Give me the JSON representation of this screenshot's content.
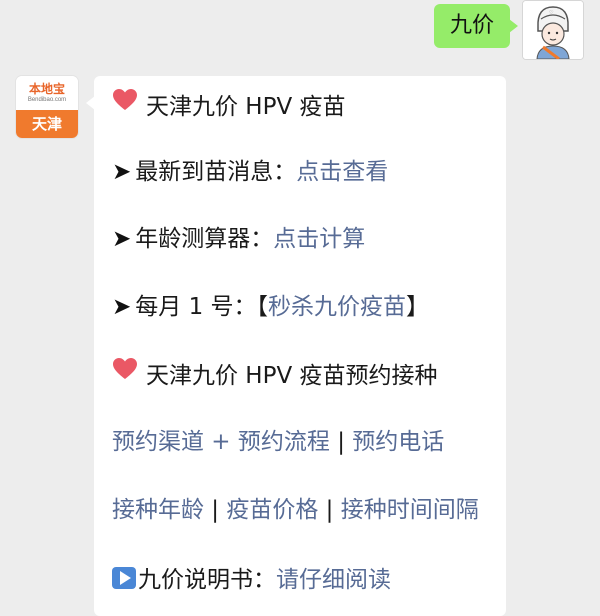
{
  "outgoing_message": {
    "text": "九价"
  },
  "account": {
    "brand": "本地宝",
    "site": "Bendibao.com",
    "city": "天津"
  },
  "message": {
    "heading1": "天津九价 HPV 疫苗",
    "item1": {
      "label": "最新到苗消息：",
      "link": "点击查看"
    },
    "item2": {
      "label": "年龄测算器：",
      "link": "点击计算"
    },
    "item3": {
      "label": "每月 1 号：",
      "link_open": "【",
      "link": "秒杀九价疫苗",
      "link_close": "】"
    },
    "heading2": "天津九价 HPV 疫苗预约接种",
    "links_row1": {
      "a": "预约渠道 + 预约流程",
      "sep": " | ",
      "b": "预约电话"
    },
    "links_row2": {
      "a": "接种年龄",
      "sep1": " | ",
      "b": "疫苗价格",
      "sep2": " | ",
      "c": "接种时间间隔"
    },
    "item4": {
      "label": "九价说明书：",
      "link": "请仔细阅读"
    }
  },
  "icons": {
    "heart": "heart-icon",
    "arrow": "arrow-right-icon",
    "play": "play-icon"
  },
  "colors": {
    "outgoing_bubble": "#95ec69",
    "link": "#576b95",
    "background": "#ededed",
    "account_orange": "#f07a2d"
  }
}
